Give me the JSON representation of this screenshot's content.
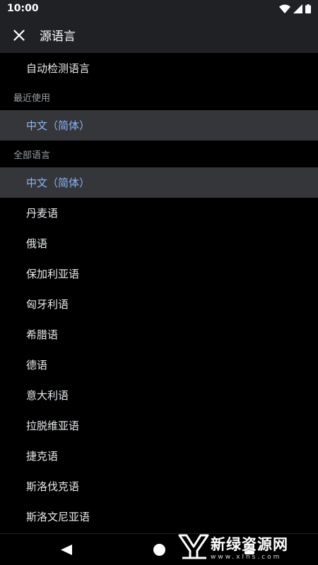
{
  "status": {
    "time": "10:00"
  },
  "header": {
    "title": "源语言"
  },
  "auto_detect": "自动检测语言",
  "sections": {
    "recent": {
      "title": "最近使用",
      "items": [
        "中文（简体）"
      ]
    },
    "all": {
      "title": "全部语言",
      "items": [
        "中文（简体）",
        "丹麦语",
        "俄语",
        "保加利亚语",
        "匈牙利语",
        "希腊语",
        "德语",
        "意大利语",
        "拉脱维亚语",
        "捷克语",
        "斯洛伐克语",
        "斯洛文尼亚语"
      ]
    }
  },
  "selected_language": "中文（简体）",
  "watermark": {
    "name": "新绿资源网",
    "url": "www.xlns.com"
  },
  "colors": {
    "background": "#000000",
    "bar": "#202124",
    "selected_row": "#35363a",
    "selected_text": "#8ab4f8",
    "section_text": "#9aa0a6"
  }
}
